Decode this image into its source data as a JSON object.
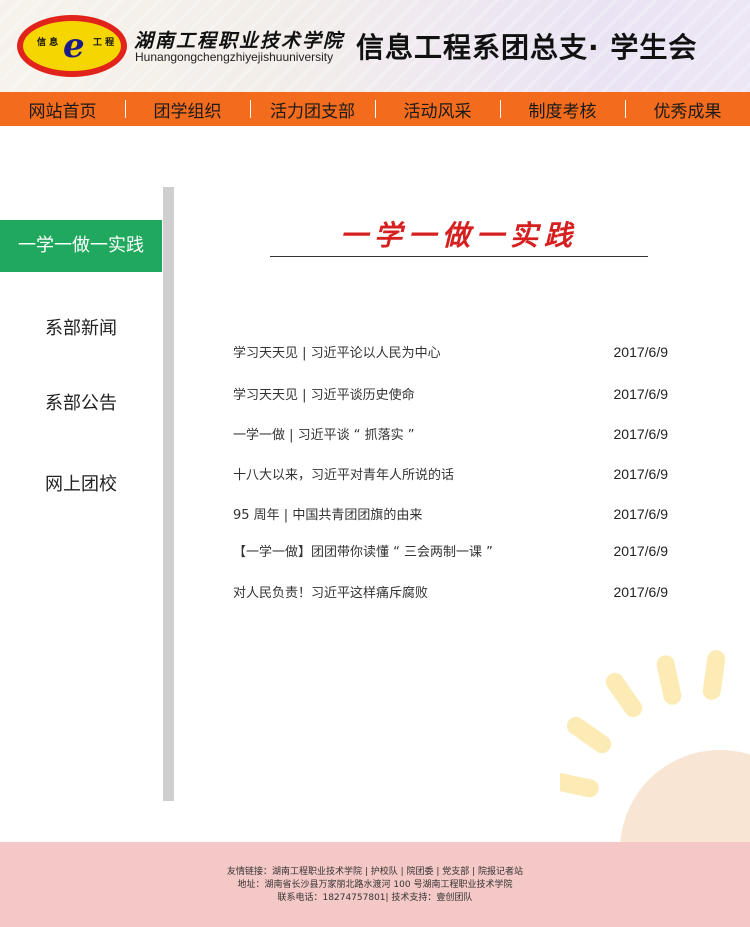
{
  "header": {
    "logo_top_left": "信 息",
    "logo_top_right": "工 程",
    "logo_letter": "e",
    "school_name": "湖南工程职业技术学院",
    "school_pinyin": "Hunangongchengzhiyejishuuniversity",
    "dept_title": "信息工程系团总支· 学生会"
  },
  "nav": {
    "items": [
      "网站首页",
      "团学组织",
      "活力团支部",
      "活动风采",
      "制度考核",
      "优秀成果"
    ]
  },
  "sidebar": {
    "items": [
      "一学一做一实践",
      "系部新闻",
      "系部公告",
      "网上团校"
    ],
    "active_index": 0
  },
  "main": {
    "section_title": "一学一做一实践",
    "news": [
      {
        "title": "学习天天见   |   习近平论以人民为中心",
        "date": "2017/6/9"
      },
      {
        "title": "学习天天见   |   习近平谈历史使命",
        "date": "2017/6/9"
      },
      {
        "title": "一学一做   |   习近平谈 “ 抓落实 ”",
        "date": "2017/6/9"
      },
      {
        "title": "十八大以来，习近平对青年人所说的话",
        "date": "2017/6/9"
      },
      {
        "title": "95 周年   |   中国共青团团旗的由来",
        "date": "2017/6/9"
      },
      {
        "title": "【一学一做】团团带你读懂 “ 三会两制一课 ”",
        "date": "2017/6/9"
      },
      {
        "title": "对人民负责！习近平这样痛斥腐败",
        "date": "2017/6/9"
      }
    ]
  },
  "footer": {
    "links": "友情链接：湖南工程职业技术学院 | 护校队 | 院团委 | 党支部 | 院报记者站",
    "address": "地址：湖南省长沙县万家丽北路水渡河 100 号湖南工程职业技术学院",
    "contact": "联系电话：18274757801| 技术支持：壹创团队"
  },
  "colors": {
    "nav_bg": "#f36b1c",
    "sidebar_active": "#20a85e",
    "title_red": "#d62020",
    "footer_bg": "#f4c8c6"
  }
}
